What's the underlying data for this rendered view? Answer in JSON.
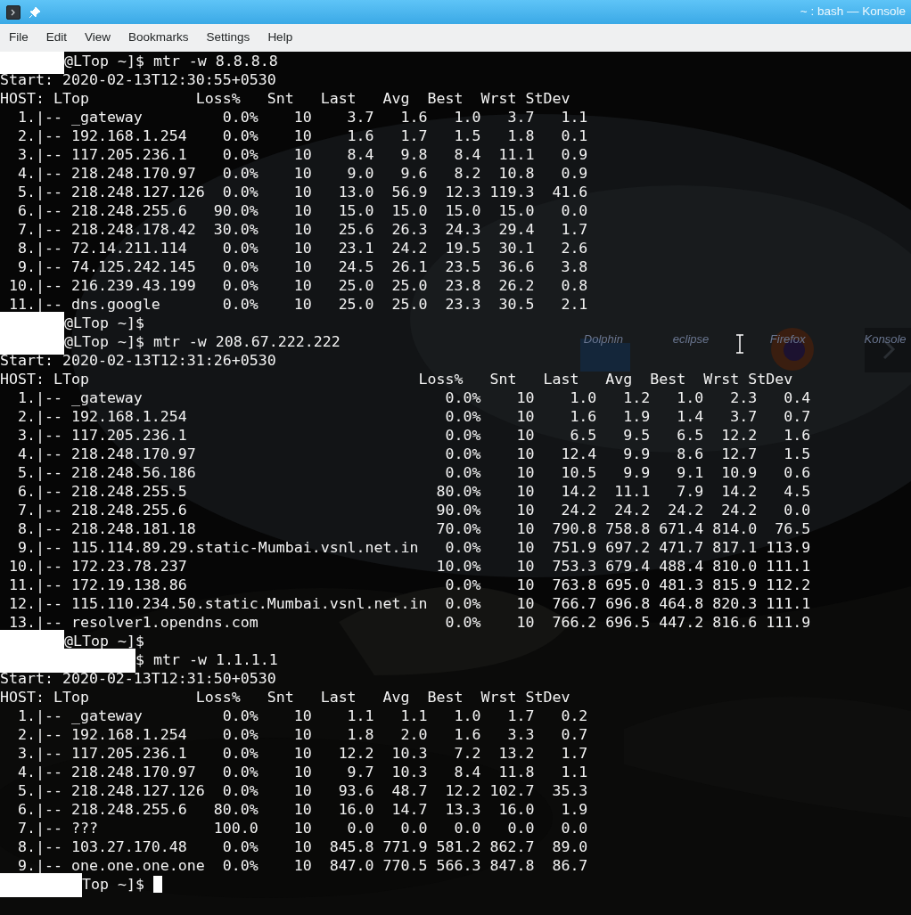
{
  "window": {
    "title": "~ : bash — Konsole"
  },
  "menu": [
    "File",
    "Edit",
    "View",
    "Bookmarks",
    "Settings",
    "Help"
  ],
  "desktop_icons": [
    {
      "label": "Dolphin",
      "kind": "folder"
    },
    {
      "label": "eclipse",
      "kind": "none"
    },
    {
      "label": "Firefox",
      "kind": "globe"
    },
    {
      "label": "Konsole",
      "kind": "terminal"
    }
  ],
  "terminal": [
    {
      "kind": "prompt",
      "prompt": "@LTop ~]$",
      "command": "mtr -w 8.8.8.8",
      "redacted": true,
      "cursor": false
    },
    {
      "kind": "report",
      "start": "Start: 2020-02-13T12:30:55+0530",
      "host_label": "HOST: LTop",
      "columns": [
        "Loss%",
        "Snt",
        "Last",
        "Avg",
        "Best",
        "Wrst",
        "StDev"
      ],
      "hops": [
        {
          "hop": "1.|--",
          "host": "_gateway",
          "values": [
            "0.0%",
            "10",
            "3.7",
            "1.6",
            "1.0",
            "3.7",
            "1.1"
          ]
        },
        {
          "hop": "2.|--",
          "host": "192.168.1.254",
          "values": [
            "0.0%",
            "10",
            "1.6",
            "1.7",
            "1.5",
            "1.8",
            "0.1"
          ]
        },
        {
          "hop": "3.|--",
          "host": "117.205.236.1",
          "values": [
            "0.0%",
            "10",
            "8.4",
            "9.8",
            "8.4",
            "11.1",
            "0.9"
          ]
        },
        {
          "hop": "4.|--",
          "host": "218.248.170.97",
          "values": [
            "0.0%",
            "10",
            "9.0",
            "9.6",
            "8.2",
            "10.8",
            "0.9"
          ]
        },
        {
          "hop": "5.|--",
          "host": "218.248.127.126",
          "values": [
            "0.0%",
            "10",
            "13.0",
            "56.9",
            "12.3",
            "119.3",
            "41.6"
          ]
        },
        {
          "hop": "6.|--",
          "host": "218.248.255.6",
          "values": [
            "90.0%",
            "10",
            "15.0",
            "15.0",
            "15.0",
            "15.0",
            "0.0"
          ]
        },
        {
          "hop": "7.|--",
          "host": "218.248.178.42",
          "values": [
            "30.0%",
            "10",
            "25.6",
            "26.3",
            "24.3",
            "29.4",
            "1.7"
          ]
        },
        {
          "hop": "8.|--",
          "host": "72.14.211.114",
          "values": [
            "0.0%",
            "10",
            "23.1",
            "24.2",
            "19.5",
            "30.1",
            "2.6"
          ]
        },
        {
          "hop": "9.|--",
          "host": "74.125.242.145",
          "values": [
            "0.0%",
            "10",
            "24.5",
            "26.1",
            "23.5",
            "36.6",
            "3.8"
          ]
        },
        {
          "hop": "10.|--",
          "host": "216.239.43.199",
          "values": [
            "0.0%",
            "10",
            "25.0",
            "25.0",
            "23.8",
            "26.2",
            "0.8"
          ]
        },
        {
          "hop": "11.|--",
          "host": "dns.google",
          "values": [
            "0.0%",
            "10",
            "25.0",
            "25.0",
            "23.3",
            "30.5",
            "2.1"
          ]
        }
      ]
    },
    {
      "kind": "prompt",
      "prompt": "@LTop ~]$",
      "redacted": true,
      "cursor": false
    },
    {
      "kind": "prompt",
      "prompt": "@LTop ~]$",
      "command": "mtr -w 208.67.222.222",
      "redacted": true,
      "cursor": false
    },
    {
      "kind": "report",
      "start": "Start: 2020-02-13T12:31:26+0530",
      "host_label": "HOST: LTop",
      "columns": [
        "Loss%",
        "Snt",
        "Last",
        "Avg",
        "Best",
        "Wrst",
        "StDev"
      ],
      "hops": [
        {
          "hop": "1.|--",
          "host": "_gateway",
          "values": [
            "0.0%",
            "10",
            "1.0",
            "1.2",
            "1.0",
            "2.3",
            "0.4"
          ]
        },
        {
          "hop": "2.|--",
          "host": "192.168.1.254",
          "values": [
            "0.0%",
            "10",
            "1.6",
            "1.9",
            "1.4",
            "3.7",
            "0.7"
          ]
        },
        {
          "hop": "3.|--",
          "host": "117.205.236.1",
          "values": [
            "0.0%",
            "10",
            "6.5",
            "9.5",
            "6.5",
            "12.2",
            "1.6"
          ]
        },
        {
          "hop": "4.|--",
          "host": "218.248.170.97",
          "values": [
            "0.0%",
            "10",
            "12.4",
            "9.9",
            "8.6",
            "12.7",
            "1.5"
          ]
        },
        {
          "hop": "5.|--",
          "host": "218.248.56.186",
          "values": [
            "0.0%",
            "10",
            "10.5",
            "9.9",
            "9.1",
            "10.9",
            "0.6"
          ]
        },
        {
          "hop": "6.|--",
          "host": "218.248.255.5",
          "values": [
            "80.0%",
            "10",
            "14.2",
            "11.1",
            "7.9",
            "14.2",
            "4.5"
          ]
        },
        {
          "hop": "7.|--",
          "host": "218.248.255.6",
          "values": [
            "90.0%",
            "10",
            "24.2",
            "24.2",
            "24.2",
            "24.2",
            "0.0"
          ]
        },
        {
          "hop": "8.|--",
          "host": "218.248.181.18",
          "values": [
            "70.0%",
            "10",
            "790.8",
            "758.8",
            "671.4",
            "814.0",
            "76.5"
          ]
        },
        {
          "hop": "9.|--",
          "host": "115.114.89.29.static-Mumbai.vsnl.net.in",
          "values": [
            "0.0%",
            "10",
            "751.9",
            "697.2",
            "471.7",
            "817.1",
            "113.9"
          ]
        },
        {
          "hop": "10.|--",
          "host": "172.23.78.237",
          "values": [
            "10.0%",
            "10",
            "753.3",
            "679.4",
            "488.4",
            "810.0",
            "111.1"
          ]
        },
        {
          "hop": "11.|--",
          "host": "172.19.138.86",
          "values": [
            "0.0%",
            "10",
            "763.8",
            "695.0",
            "481.3",
            "815.9",
            "112.2"
          ]
        },
        {
          "hop": "12.|--",
          "host": "115.110.234.50.static.Mumbai.vsnl.net.in",
          "values": [
            "0.0%",
            "10",
            "766.7",
            "696.8",
            "464.8",
            "820.3",
            "111.1"
          ]
        },
        {
          "hop": "13.|--",
          "host": "resolver1.opendns.com",
          "values": [
            "0.0%",
            "10",
            "766.2",
            "696.5",
            "447.2",
            "816.6",
            "111.9"
          ]
        }
      ]
    },
    {
      "kind": "prompt",
      "prompt": "@LTop ~]$",
      "redacted": true,
      "cursor": false
    },
    {
      "kind": "prompt",
      "prompt": "$",
      "command": "mtr -w 1.1.1.1",
      "redacted": true,
      "cursor": false
    },
    {
      "kind": "report",
      "start": "Start: 2020-02-13T12:31:50+0530",
      "host_label": "HOST: LTop",
      "columns": [
        "Loss%",
        "Snt",
        "Last",
        "Avg",
        "Best",
        "Wrst",
        "StDev"
      ],
      "hops": [
        {
          "hop": "1.|--",
          "host": "_gateway",
          "values": [
            "0.0%",
            "10",
            "1.1",
            "1.1",
            "1.0",
            "1.7",
            "0.2"
          ]
        },
        {
          "hop": "2.|--",
          "host": "192.168.1.254",
          "values": [
            "0.0%",
            "10",
            "1.8",
            "2.0",
            "1.6",
            "3.3",
            "0.7"
          ]
        },
        {
          "hop": "3.|--",
          "host": "117.205.236.1",
          "values": [
            "0.0%",
            "10",
            "12.2",
            "10.3",
            "7.2",
            "13.2",
            "1.7"
          ]
        },
        {
          "hop": "4.|--",
          "host": "218.248.170.97",
          "values": [
            "0.0%",
            "10",
            "9.7",
            "10.3",
            "8.4",
            "11.8",
            "1.1"
          ]
        },
        {
          "hop": "5.|--",
          "host": "218.248.127.126",
          "values": [
            "0.0%",
            "10",
            "93.6",
            "48.7",
            "12.2",
            "102.7",
            "35.3"
          ]
        },
        {
          "hop": "6.|--",
          "host": "218.248.255.6",
          "values": [
            "80.0%",
            "10",
            "16.0",
            "14.7",
            "13.3",
            "16.0",
            "1.9"
          ]
        },
        {
          "hop": "7.|--",
          "host": "???",
          "values": [
            "100.0",
            "10",
            "0.0",
            "0.0",
            "0.0",
            "0.0",
            "0.0"
          ]
        },
        {
          "hop": "8.|--",
          "host": "103.27.170.48",
          "values": [
            "0.0%",
            "10",
            "845.8",
            "771.9",
            "581.2",
            "862.7",
            "89.0"
          ]
        },
        {
          "hop": "9.|--",
          "host": "one.one.one.one",
          "values": [
            "0.0%",
            "10",
            "847.0",
            "770.5",
            "566.3",
            "847.8",
            "86.7"
          ]
        }
      ]
    },
    {
      "kind": "prompt",
      "prompt": "Top ~]$",
      "redacted": true,
      "cursor": true
    }
  ]
}
